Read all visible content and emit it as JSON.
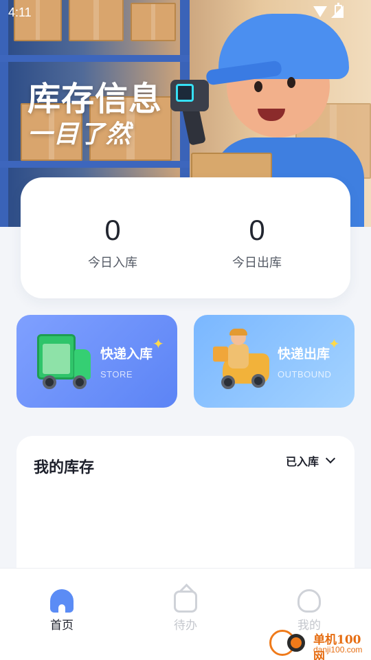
{
  "status_bar": {
    "time": "4:11",
    "icons": [
      "wifi-icon",
      "signal-icon",
      "battery-icon"
    ]
  },
  "banner": {
    "title": "库存信息",
    "subtitle": "一目了然"
  },
  "stats": [
    {
      "value": "0",
      "label": "今日入库"
    },
    {
      "value": "0",
      "label": "今日出库"
    }
  ],
  "actions": {
    "store": {
      "title": "快递入库",
      "subtitle": "STORE",
      "icon": "delivery-truck-icon"
    },
    "outbound": {
      "title": "快递出库",
      "subtitle": "OUTBOUND",
      "icon": "scooter-courier-icon"
    }
  },
  "inventory": {
    "title": "我的库存",
    "filter": "已入库"
  },
  "bottom_nav": [
    {
      "label": "首页",
      "icon": "home-icon",
      "active": true
    },
    {
      "label": "待办",
      "icon": "todo-bag-icon",
      "active": false
    },
    {
      "label": "我的",
      "icon": "profile-icon",
      "active": false
    }
  ],
  "watermark": {
    "brand": "单机100网",
    "url": "danji100.com"
  },
  "colors": {
    "accent": "#5b8cf5",
    "store_card": "#6a8ff8",
    "outbound_card": "#8fc3ff",
    "nav_active": "#1c1f2a",
    "nav_inactive": "#c4c7cd",
    "watermark": "#e66d12"
  }
}
